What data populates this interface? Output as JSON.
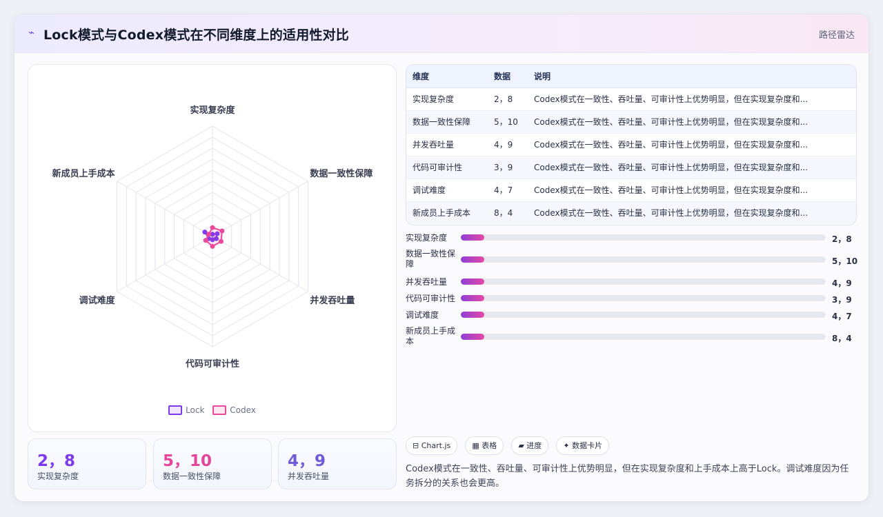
{
  "header": {
    "icon": "⌁",
    "title": "Lock模式与Codex模式在不同维度上的适用性对比",
    "tag": "路径雷达"
  },
  "colors": {
    "lock": "#7c3aed",
    "codex": "#ec4899",
    "accent": "#6d4ae0"
  },
  "chart_data": {
    "type": "radar",
    "axes": [
      "实现复杂度",
      "数据一致性保障",
      "并发吞吐量",
      "代码可审计性",
      "调试难度",
      "新成员上手成本"
    ],
    "series": [
      {
        "name": "Lock",
        "values": [
          2,
          5,
          4,
          3,
          4,
          8
        ]
      },
      {
        "name": "Codex",
        "values": [
          8,
          10,
          9,
          9,
          7,
          4
        ]
      }
    ],
    "rmax": 100,
    "rings": 10,
    "legend_position": "bottom"
  },
  "stats": [
    {
      "value": "2，8",
      "label": "实现复杂度"
    },
    {
      "value": "5，10",
      "label": "数据一致性保障"
    },
    {
      "value": "4，9",
      "label": "并发吞吐量"
    }
  ],
  "table": {
    "headers": [
      "维度",
      "数据",
      "说明"
    ],
    "rows": [
      [
        "实现复杂度",
        "2，8",
        "Codex模式在一致性、吞吐量、可审计性上优势明显，但在实现复杂度和..."
      ],
      [
        "数据一致性保障",
        "5，10",
        "Codex模式在一致性、吞吐量、可审计性上优势明显，但在实现复杂度和..."
      ],
      [
        "并发吞吐量",
        "4，9",
        "Codex模式在一致性、吞吐量、可审计性上优势明显，但在实现复杂度和..."
      ],
      [
        "代码可审计性",
        "3，9",
        "Codex模式在一致性、吞吐量、可审计性上优势明显，但在实现复杂度和..."
      ],
      [
        "调试难度",
        "4，7",
        "Codex模式在一致性、吞吐量、可审计性上优势明显，但在实现复杂度和..."
      ],
      [
        "新成员上手成本",
        "8，4",
        "Codex模式在一致性、吞吐量、可审计性上优势明显，但在实现复杂度和..."
      ]
    ]
  },
  "bars": [
    {
      "label": "实现复杂度",
      "value": "2，8",
      "fill": 0.065
    },
    {
      "label": "数据一致性保障",
      "value": "5，10",
      "fill": 0.065
    },
    {
      "label": "并发吞吐量",
      "value": "4，9",
      "fill": 0.065
    },
    {
      "label": "代码可审计性",
      "value": "3，9",
      "fill": 0.065
    },
    {
      "label": "调试难度",
      "value": "4，7",
      "fill": 0.065
    },
    {
      "label": "新成员上手成本",
      "value": "8，4",
      "fill": 0.065
    }
  ],
  "chips": [
    "⊟ Chart.js",
    "▦ 表格",
    "▰ 进度",
    "✦ 数据卡片"
  ],
  "summary": "Codex模式在一致性、吞吐量、可审计性上优势明显，但在实现复杂度和上手成本上高于Lock。调试难度因为任务拆分的关系也会更高。"
}
